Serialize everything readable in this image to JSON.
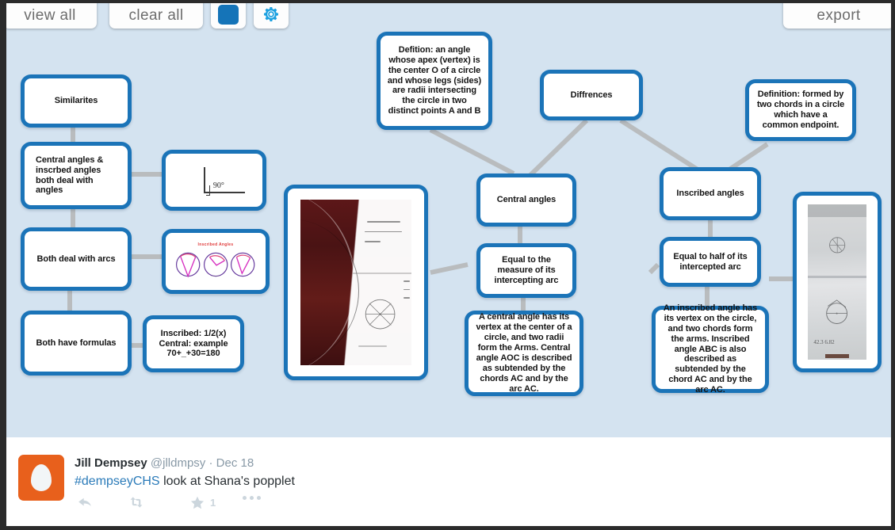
{
  "toolbar": {
    "view_all": "view all",
    "clear_all": "clear all",
    "color_swatch_name": "blue-square",
    "color_swatch_hex": "#1574b8",
    "settings_icon": "gear-icon",
    "export": "export"
  },
  "canvas": {
    "background_hex": "#d4e3f0",
    "node_border_hex": "#1b74b8",
    "connector_hex": "#b9bcbe"
  },
  "popples": [
    {
      "id": "similarites",
      "text": "Similarites"
    },
    {
      "id": "central-inscribed-angles",
      "text": "Central angles & inscrbed angles both deal with angles"
    },
    {
      "id": "right-angle-image",
      "text": "",
      "image_caption": "90°"
    },
    {
      "id": "both-deal-with-arcs",
      "text": "Both deal with arcs"
    },
    {
      "id": "three-circles-image",
      "text": "",
      "image_title": "Inscribed Angles"
    },
    {
      "id": "both-have-formulas",
      "text": "Both have formulas"
    },
    {
      "id": "formulas-detail",
      "text": "Inscribed: 1/2(x)\nCentral: example\n70+_+30=180"
    },
    {
      "id": "central-angle-definition",
      "text": "Defition: an angle whose apex (vertex) is the center O of a circle and whose legs (sides) are radii intersecting the circle in two distinct points A and B"
    },
    {
      "id": "notebook-photo",
      "text": ""
    },
    {
      "id": "diffrences",
      "text": "Diffrences"
    },
    {
      "id": "central-angles",
      "text": "Central angles"
    },
    {
      "id": "central-equal-measure",
      "text": "Equal to the measure of its intercepting arc"
    },
    {
      "id": "central-angle-detail",
      "text": "A central angle has its vertex at the center of a circle, and two radii form the Arms. Central angle AOC is described as subtended by the chords AC and by the arc AC."
    },
    {
      "id": "inscribed-definition",
      "text": "Definition: formed by two chords in a circle which have a common endpoint."
    },
    {
      "id": "inscribed-angles",
      "text": "Inscribed angles"
    },
    {
      "id": "inscribed-equal-half",
      "text": "Equal to half of its intercepted arc"
    },
    {
      "id": "inscribed-angle-detail",
      "text": "An inscribed angle has its vertex on the circle, and two chords form the arms. Inscribed angle ABC is also described as subtended by the chord AC and by the arc AC."
    },
    {
      "id": "worksheet-photo",
      "text": ""
    }
  ],
  "tweet": {
    "display_name": "Jill Dempsey",
    "handle": "@jlldmpsy",
    "separator": "·",
    "date": "Dec 18",
    "hashtag": "#dempseyCHS",
    "body": "look at Shana's popplet",
    "reply_icon": "reply-arrow-icon",
    "retweet_icon": "retweet-icon",
    "favorite_icon": "star-icon",
    "favorite_count": "1",
    "more_icon": "more-dots-icon",
    "avatar_hex": "#e8601c",
    "link_hex": "#2b7bb9"
  }
}
